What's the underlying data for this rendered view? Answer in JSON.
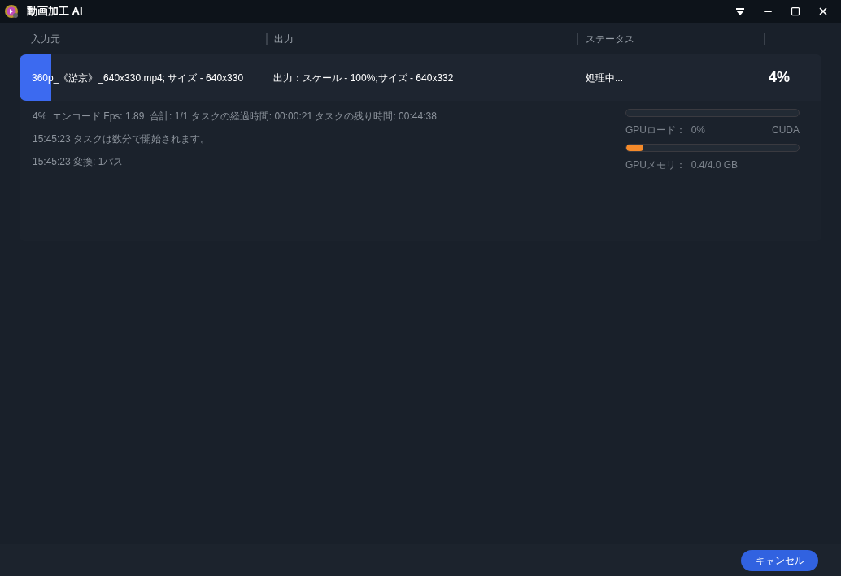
{
  "window": {
    "title": "動画加工 AI"
  },
  "table": {
    "columns": [
      "入力元",
      "出力",
      "ステータス"
    ]
  },
  "task": {
    "source": "360p_《游京》_640x330.mp4; サイズ - 640x330",
    "output": "出力：スケール - 100%;サイズ - 640x332",
    "status": "処理中...",
    "percent": "4%",
    "level": 0.04,
    "log": [
      "4%  エンコード Fps: 1.89  合計: 1/1 タスクの経過時間: 00:00:21 タスクの残り時間: 00:44:38",
      "15:45:23 タスクは数分で開始されます。",
      "15:45:23 変換: 1パス"
    ],
    "gpu": [
      {
        "label": "GPUロード：  0%",
        "extra": "CUDA"
      },
      {
        "label": "GPUメモリ：  0.4/4.0 GB",
        "level": 0.1
      }
    ]
  },
  "buttons": [
    "キャンセル"
  ]
}
